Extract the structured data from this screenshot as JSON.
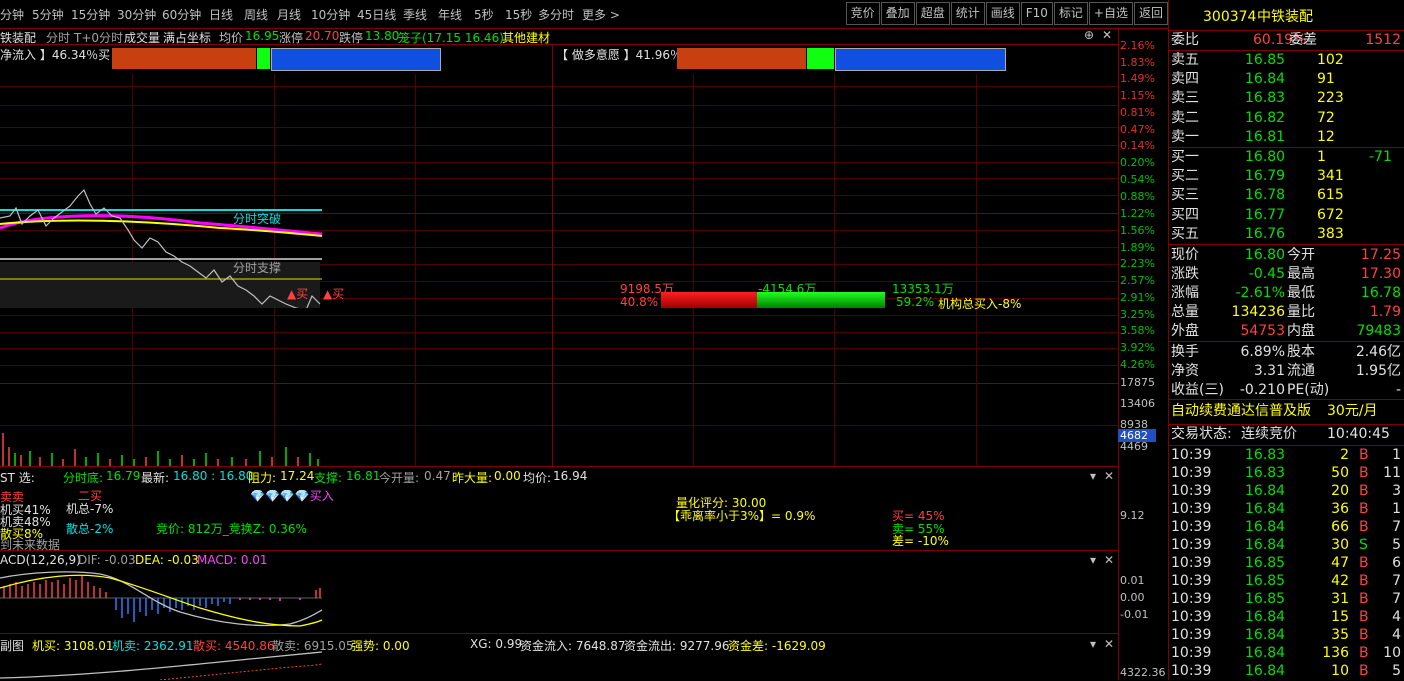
{
  "toolbar": {
    "periods": [
      "分钟",
      "5分钟",
      "15分钟",
      "30分钟",
      "60分钟",
      "日线",
      "周线",
      "月线",
      "10分钟",
      "45日线",
      "季线",
      "年线",
      "5秒",
      "15秒",
      "多分时",
      "更多 >"
    ],
    "tools": [
      "竞价",
      "叠加",
      "超盘",
      "统计",
      "画线",
      "F10",
      "标记",
      "+自选",
      "返回"
    ]
  },
  "header": {
    "name": "铁装配",
    "minute": "分时",
    "t0": "T+0分时",
    "vol": "成交量",
    "full": "满占坐标",
    "avg_label": "均价",
    "avg": "16.95",
    "zt_label": "涨停",
    "zt": "20.70",
    "dt_label": "跌停",
    "dt": "13.80",
    "cage": "笼子(17.15 16.46)",
    "sector": "其他建材"
  },
  "panel": {
    "net_inflow": "净流入 】46.34％买",
    "bull_bear": "【 做多意愿 】41.96％买",
    "buy_amt": "9198.5万",
    "sell_amt": "-4154.6万",
    "net_amt": "13353.1万",
    "buy_pct": "40.8%",
    "sell_pct": "59.2%",
    "inst_buy": "机构总买入-8%",
    "support_label": "分时突破",
    "resist_label": "分时支撑",
    "buy_mark1": "▲买",
    "buy_mark2": "▲买"
  },
  "axis": {
    "up": [
      "2.16%",
      "1.83%",
      "1.49%",
      "1.15%",
      "0.81%",
      "0.47%",
      "0.14%"
    ],
    "down": [
      "0.20%",
      "0.54%",
      "0.88%",
      "1.22%",
      "1.56%",
      "1.89%",
      "2.23%",
      "2.57%",
      "2.91%",
      "3.25%",
      "3.58%",
      "3.92%",
      "4.26%"
    ],
    "vol": [
      "17875",
      "13406",
      "8938",
      "4469"
    ],
    "vol_cursor": "4682",
    "sub1": "9.12",
    "macd": [
      "0.01",
      "0.00",
      "-0.01"
    ],
    "sub3": "4322.36"
  },
  "sub1": {
    "st": "ST 选:",
    "floor_label": "分时底:",
    "floor": "16.79",
    "last_label": "最新:",
    "last": "16.80 : 16.80",
    "res_label": "阻力:",
    "res": "17.24",
    "sup_label": "支撑:",
    "sup": "16.81",
    "open_label": "今开量:",
    "open": "0.47",
    "yv_label": "昨大量:",
    "yv": "0.00",
    "avg_label": "均价:",
    "avg": "16.94",
    "top_sell": "卖卖",
    "second": "二买",
    "marks": "买入",
    "ji": "机买41%",
    "ji2": "机卖48%",
    "sanmai": "散买8%",
    "ji_total": "机总-7%",
    "san_total": "散总-2%",
    "bid": "竞价:  812万_竞换Z: 0.36%",
    "nodata": "到未来数据",
    "quant": "量化评分: 30.00",
    "dev": "【乖离率小于3%】= 0.9%",
    "mai": "买= 45%",
    "mai2": "卖= 55%",
    "cha": "差= -10%"
  },
  "macd": {
    "label": "ACD(12,26,9)",
    "dif": "DIF: -0.03",
    "dea": "DEA: -0.03",
    "macd": "MACD: 0.01"
  },
  "sub3": {
    "label": "副图",
    "jm": "机买: 3108.01",
    "jmc": "机卖: 2362.91",
    "sm": "散买: 4540.86",
    "smc": "散卖: 6915.05",
    "qs": "强势: 0.00",
    "xg": "XG: 0.99",
    "in": "资金流入: 7648.87",
    "out": "资金流出: 9277.96",
    "diff": "资金差: -1629.09"
  },
  "quote": {
    "code": "300374",
    "name": "中铁装配",
    "wb_label": "委比",
    "wb": "60.19%",
    "wc_label": "委差",
    "wc": "1512",
    "asks": [
      {
        "l": "卖五",
        "p": "16.85",
        "v": "102"
      },
      {
        "l": "卖四",
        "p": "16.84",
        "v": "91"
      },
      {
        "l": "卖三",
        "p": "16.83",
        "v": "223"
      },
      {
        "l": "卖二",
        "p": "16.82",
        "v": "72"
      },
      {
        "l": "卖一",
        "p": "16.81",
        "v": "12"
      }
    ],
    "bids": [
      {
        "l": "买一",
        "p": "16.80",
        "v": "1",
        "c": "-71"
      },
      {
        "l": "买二",
        "p": "16.79",
        "v": "341",
        "c": ""
      },
      {
        "l": "买三",
        "p": "16.78",
        "v": "615",
        "c": ""
      },
      {
        "l": "买四",
        "p": "16.77",
        "v": "672",
        "c": ""
      },
      {
        "l": "买五",
        "p": "16.76",
        "v": "383",
        "c": ""
      }
    ],
    "stats": [
      {
        "a": "现价",
        "av": "16.80",
        "b": "今开",
        "bv": "17.25"
      },
      {
        "a": "涨跌",
        "av": "-0.45",
        "b": "最高",
        "bv": "17.30"
      },
      {
        "a": "涨幅",
        "av": "-2.61%",
        "b": "最低",
        "bv": "16.78"
      },
      {
        "a": "总量",
        "av": "134236",
        "b": "量比",
        "bv": "1.79"
      },
      {
        "a": "外盘",
        "av": "54753",
        "b": "内盘",
        "bv": "79483"
      }
    ],
    "stats2": [
      {
        "a": "换手",
        "av": "6.89%",
        "b": "股本",
        "bv": "2.46亿"
      },
      {
        "a": "净资",
        "av": "3.31",
        "b": "流通",
        "bv": "1.95亿"
      },
      {
        "a": "收益(三)",
        "av": "-0.210",
        "b": "PE(动)",
        "bv": "-"
      }
    ],
    "promo": "自动续费通达信普及版",
    "promo_price": "30元/月",
    "state_label": "交易状态:",
    "state": "连续竞价",
    "state_time": "10:40:45",
    "ticks": [
      {
        "t": "10:39",
        "p": "16.83",
        "v": "2",
        "d": "B",
        "n": "1"
      },
      {
        "t": "10:39",
        "p": "16.83",
        "v": "50",
        "d": "B",
        "n": "11"
      },
      {
        "t": "10:39",
        "p": "16.84",
        "v": "20",
        "d": "B",
        "n": "3"
      },
      {
        "t": "10:39",
        "p": "16.84",
        "v": "36",
        "d": "B",
        "n": "1"
      },
      {
        "t": "10:39",
        "p": "16.84",
        "v": "66",
        "d": "B",
        "n": "7"
      },
      {
        "t": "10:39",
        "p": "16.84",
        "v": "30",
        "d": "S",
        "n": "5"
      },
      {
        "t": "10:39",
        "p": "16.85",
        "v": "47",
        "d": "B",
        "n": "6"
      },
      {
        "t": "10:39",
        "p": "16.85",
        "v": "42",
        "d": "B",
        "n": "7"
      },
      {
        "t": "10:39",
        "p": "16.85",
        "v": "31",
        "d": "B",
        "n": "7"
      },
      {
        "t": "10:39",
        "p": "16.84",
        "v": "15",
        "d": "B",
        "n": "4"
      },
      {
        "t": "10:39",
        "p": "16.84",
        "v": "35",
        "d": "B",
        "n": "4"
      },
      {
        "t": "10:39",
        "p": "16.84",
        "v": "136",
        "d": "B",
        "n": "10"
      },
      {
        "t": "10:39",
        "p": "16.84",
        "v": "10",
        "d": "B",
        "n": "5"
      }
    ]
  }
}
